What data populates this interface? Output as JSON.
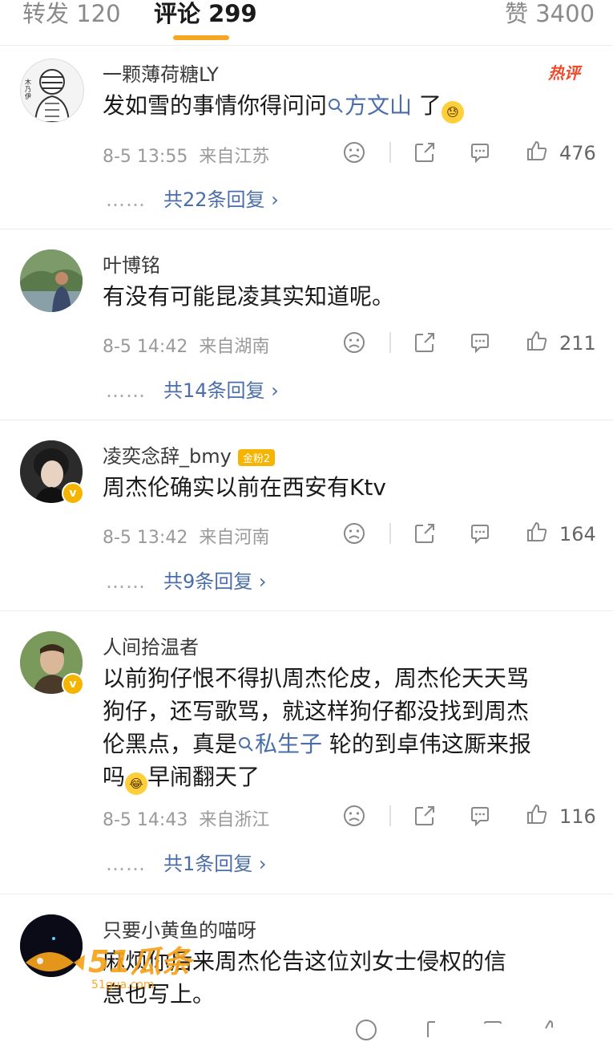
{
  "tabs": [
    {
      "label": "转发 120"
    },
    {
      "label": "评论 299"
    },
    {
      "label": "赞 3400"
    }
  ],
  "comments": [
    {
      "username": "一颗薄荷糖LY",
      "hot_badge": "热评",
      "text_before": "发如雪的事情你得问问",
      "mention": "方文山",
      "text_after": " 了",
      "date": "8-5 13:55",
      "location": "来自江苏",
      "likes": "476",
      "replies": "共22条回复"
    },
    {
      "username": "叶博铭",
      "text": "有没有可能昆凌其实知道呢。",
      "date": "8-5 14:42",
      "location": "来自湖南",
      "likes": "211",
      "replies": "共14条回复"
    },
    {
      "username": "凌奕念辞_bmy",
      "fan_badge": "金粉2",
      "text": "周杰伦确实以前在西安有Ktv",
      "date": "8-5 13:42",
      "location": "来自河南",
      "likes": "164",
      "replies": "共9条回复"
    },
    {
      "username": "人间拾温者",
      "line1": "以前狗仔恨不得扒周杰伦皮，周杰伦天天骂",
      "line2": "狗仔，还写歌骂，就这样狗仔都没找到周杰",
      "line3_before": "伦黑点，真是",
      "mention": "私生子",
      "line3_after": " 轮的到卓伟这厮来报",
      "line4_before": "吗",
      "line4_after": "早闹翻天了",
      "date": "8-5 14:43",
      "location": "来自浙江",
      "likes": "116",
      "replies": "共1条回复"
    },
    {
      "username": "只要小黄鱼的喵呀",
      "line1": "麻烦你后来周杰伦告这位刘女士侵权的信",
      "line2": "息也写上。"
    }
  ],
  "reply_dots": "……",
  "avatar_text": "木乃伊",
  "watermark": {
    "logo": "51瓜条",
    "url": "51gua.com"
  },
  "colors": {
    "accent": "#f5a623",
    "link": "#4a6ea9",
    "hot": "#f04a2c",
    "badge": "#f5b400"
  }
}
